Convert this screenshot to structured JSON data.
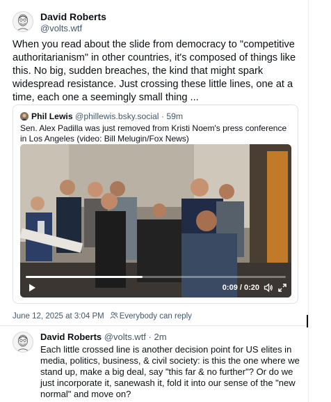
{
  "post": {
    "author_name": "David Roberts",
    "author_handle": "@volts.wtf",
    "text": "When you read about the slide from democracy to \"competitive authoritarianism\" in other countries, it's composed of things like this. No big, sudden breaches, the kind that might spark widespread resistance. Just crossing these little lines, one at a time, each one a seemingly small thing ...",
    "date": "June 12, 2025 at 3:04 PM",
    "reply_setting": "Everybody can reply",
    "avatar_icon": "sketch-portrait-avatar"
  },
  "quote": {
    "author_name": "Phil Lewis",
    "author_handle": "@phillewis.bsky.social",
    "separator": "·",
    "time": "59m",
    "text": "Sen. Alex Padilla was just removed from Kristi Noem's press conference in Los Angeles (video: Bill Melugin/Fox News)",
    "video": {
      "time_readout": "0:09 / 0:20",
      "progress": 0.45,
      "play_icon": "play-icon",
      "volume_icon": "volume-icon",
      "fullscreen_icon": "fullscreen-icon"
    }
  },
  "reply": {
    "author_name": "David Roberts",
    "author_handle": "@volts.wtf",
    "separator": "·",
    "time": "2m",
    "text": "Each little crossed line is another decision point for US elites in media, politics, business, & civil society: is this the one where we stand up, make a big deal, say \"this far & no further\"? Or do we just incorporate it, sanewash it, fold it into our sense of the \"new normal\" and move on?"
  },
  "colors": {
    "text_primary": "#0b0f14",
    "text_secondary": "#42576c",
    "border": "#dfe3e8"
  }
}
